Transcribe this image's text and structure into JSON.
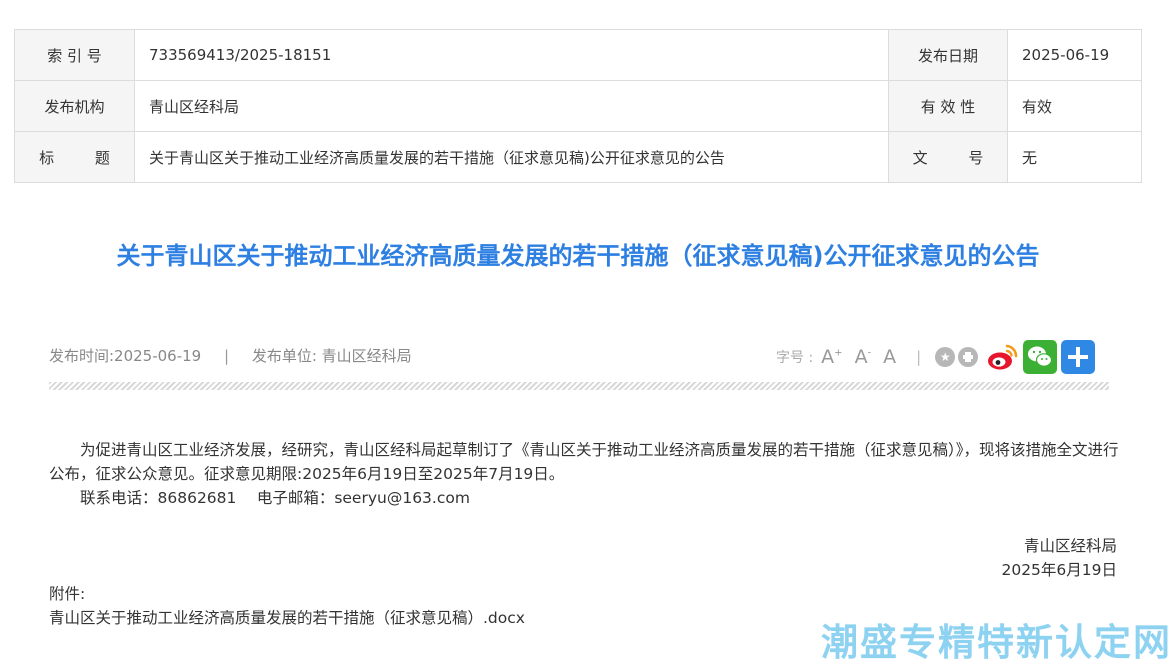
{
  "meta_table": {
    "index_label": "索 引 号",
    "index_value": "733569413/2025-18151",
    "date_label": "发布日期",
    "date_value": "2025-06-19",
    "org_label": "发布机构",
    "org_value": "青山区经科局",
    "validity_label": "有 效 性",
    "validity_value": "有效",
    "title_label": "标 题",
    "title_value": "关于青山区关于推动工业经济高质量发展的若干措施（征求意见稿)公开征求意见的公告",
    "docno_label": "文 号",
    "docno_value": "无"
  },
  "article": {
    "title": "关于青山区关于推动工业经济高质量发展的若干措施（征求意见稿)公开征求意见的公告",
    "publish_time": "发布时间:2025-06-19",
    "separator": "|",
    "publisher": "发布单位: 青山区经科局",
    "paragraph1": "为促进青山区工业经济发展，经研究，青山区经科局起草制订了《青山区关于推动工业经济高质量发展的若干措施（征求意见稿）》，现将该措施全文进行公布，征求公众意见。征求意见期限:2025年6月19日至2025年7月19日。",
    "contact": "联系电话：86862681　 电子邮箱：seeryu@163.com",
    "signature_org": "青山区经科局",
    "signature_date": "2025年6月19日",
    "attachment_label": "附件:",
    "attachment_file": "青山区关于推动工业经济高质量发展的若干措施（征求意见稿）.docx"
  },
  "toolbar": {
    "font_size_label": "字号 :",
    "font_large": "A",
    "font_medium": "A",
    "font_small": "A",
    "separator": "|",
    "icons": [
      "favorite-icon",
      "print-icon",
      "weibo-icon",
      "wechat-icon",
      "share-plus-icon"
    ],
    "brand_colors": {
      "wechat": "#3cb034",
      "plus": "#2f88e3",
      "weibo": "#e6162d",
      "title": "#2d7fe2"
    }
  },
  "watermark": "潮盛专精特新认定网"
}
